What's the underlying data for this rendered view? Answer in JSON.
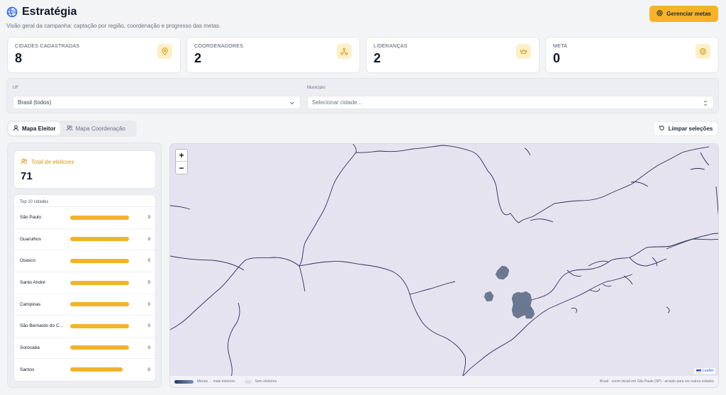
{
  "page": {
    "title": "Estratégia",
    "subtitle": "Visão geral da campanha: captação por região, coordenação e progresso das metas.",
    "manage_goals_label": "Gerenciar metas"
  },
  "stats": [
    {
      "label": "CIDADES CADASTRADAS",
      "value": "8",
      "icon": "map-pin-icon"
    },
    {
      "label": "COORDENADORES",
      "value": "2",
      "icon": "network-icon"
    },
    {
      "label": "LIDERANÇAS",
      "value": "2",
      "icon": "crown-icon"
    },
    {
      "label": "META",
      "value": "0",
      "icon": "target-icon"
    }
  ],
  "filters": {
    "uf_label": "UF",
    "uf_value": "Brasil (todos)",
    "municipio_label": "Município",
    "municipio_placeholder": "Selecionar cidade..."
  },
  "view_toggle": {
    "tab_eleitor": "Mapa Eleitor",
    "tab_coordenacao": "Mapa Coordenação",
    "active": "tab_eleitor"
  },
  "clear_label": "Limpar seleções",
  "total": {
    "label": "Total de eleitores",
    "value": "71"
  },
  "top_cities": {
    "title": "Top 10 cidades",
    "max": 9,
    "rows": [
      {
        "city": "São Paulo",
        "count": 9
      },
      {
        "city": "Guarulhos",
        "count": 9
      },
      {
        "city": "Osasco",
        "count": 9
      },
      {
        "city": "Santo André",
        "count": 9
      },
      {
        "city": "Campinas",
        "count": 9
      },
      {
        "city": "São Bernardo do C...",
        "count": 9
      },
      {
        "city": "Sorocaba",
        "count": 9
      },
      {
        "city": "Santos",
        "count": 8
      }
    ]
  },
  "map": {
    "zoom_in": "+",
    "zoom_out": "−",
    "legend_gradient": "Menos → mais eleitores",
    "legend_none": "Sem eleitores",
    "hint": "Brasil · zoom inicial em São Paulo (SP) · arraste para ver outros estados",
    "attribution": "Leaflet"
  },
  "colors": {
    "accent": "#f5b327",
    "region_fill": "#6b7891",
    "map_bg": "#e6e3f0"
  }
}
